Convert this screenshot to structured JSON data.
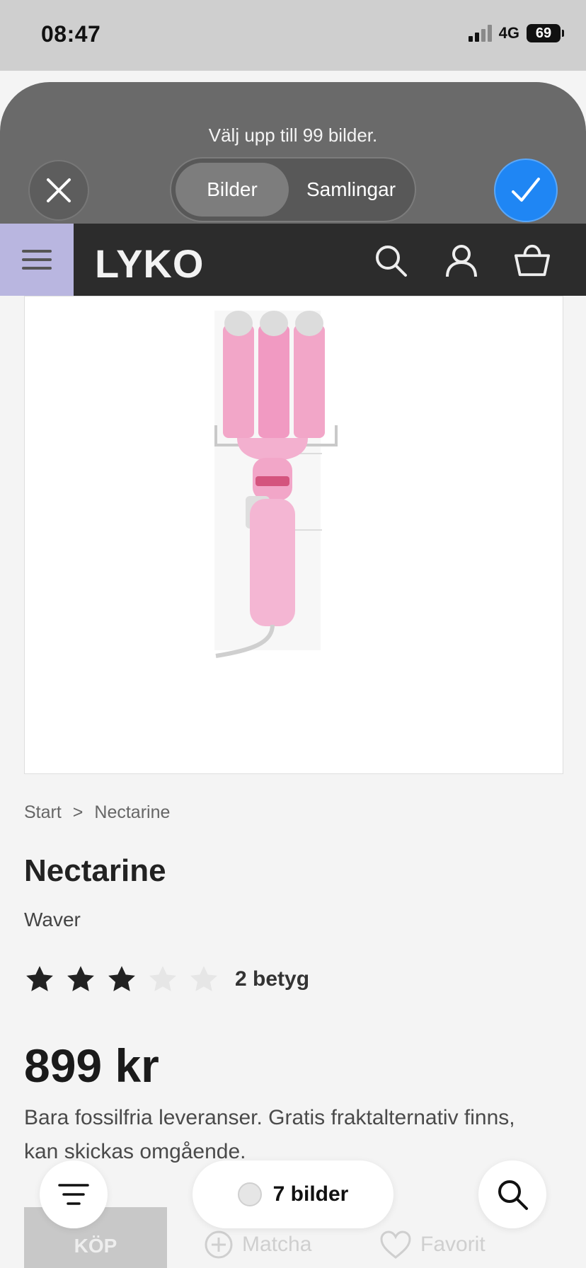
{
  "status": {
    "time": "08:47",
    "network": "4G",
    "battery": "69"
  },
  "picker": {
    "hint": "Välj upp till 99 bilder.",
    "tabs": [
      "Bilder",
      "Samlingar"
    ],
    "active_tab": "Bilder",
    "selection_count": "7 bilder",
    "accent_color": "#1f86f4"
  },
  "site": {
    "logo": "LYKO"
  },
  "breadcrumb": [
    "Start",
    ">",
    "Nectarine"
  ],
  "product": {
    "brand": "Nectarine",
    "name": "Waver",
    "rating_stars": 3,
    "rating_max": 5,
    "rating_count": "2 betyg",
    "price": "899 kr",
    "delivery": "Bara fossilfria leveranser. Gratis fraktalternativ finns, kan skickas omgående."
  },
  "actions": {
    "buy": "KÖP",
    "match": "Matcha",
    "favorite": "Favorit"
  },
  "icons": [
    "close-icon",
    "checkmark-icon",
    "menu-icon",
    "search-icon",
    "user-icon",
    "basket-icon",
    "star-icon",
    "filter-icon",
    "plus-circle-icon",
    "heart-icon"
  ]
}
